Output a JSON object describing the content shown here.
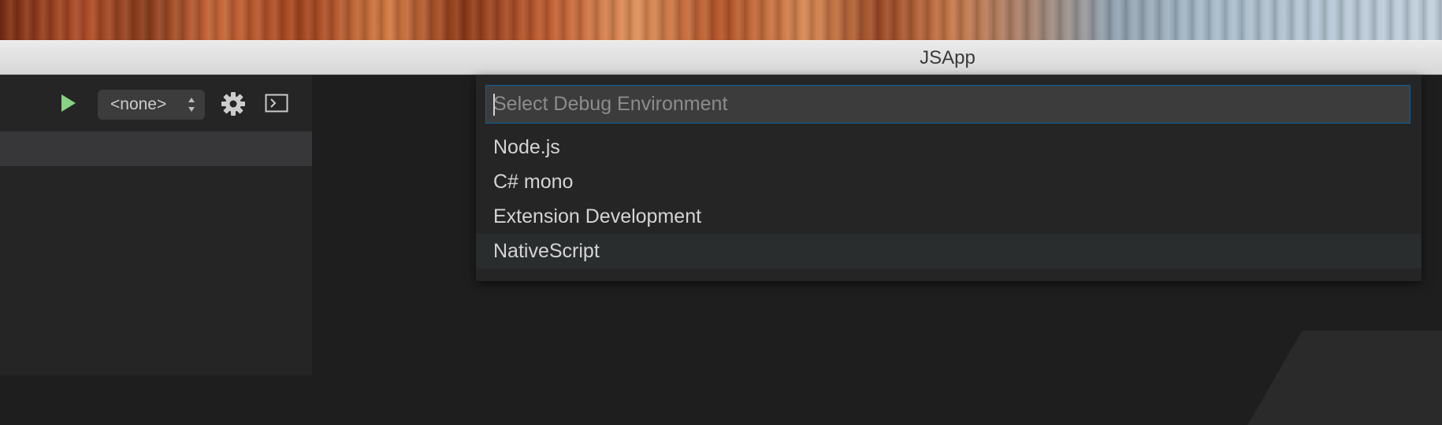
{
  "window": {
    "title": "JSApp"
  },
  "debug_toolbar": {
    "config_selected": "<none>",
    "play_icon": "play-icon",
    "gear_icon": "gear-icon",
    "console_icon": "console-icon",
    "accent_green": "#89d185"
  },
  "quick_open": {
    "placeholder": "Select Debug Environment",
    "value": "",
    "items": [
      {
        "label": "Node.js"
      },
      {
        "label": "C# mono"
      },
      {
        "label": "Extension Development"
      },
      {
        "label": "NativeScript",
        "selected": true
      }
    ],
    "focus_border": "#0e639c"
  }
}
